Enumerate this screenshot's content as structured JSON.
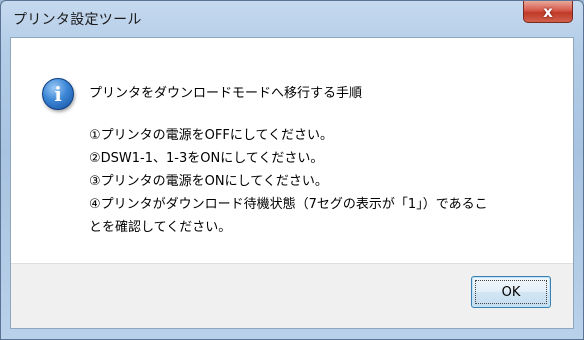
{
  "window": {
    "title": "プリンタ設定ツール",
    "close_label": "x"
  },
  "dialog": {
    "icon": "information-icon",
    "icon_glyph": "i",
    "heading": "プリンタをダウンロードモードへ移行する手順",
    "steps": [
      "①プリンタの電源をOFFにしてください。",
      "②DSW1-1、1-3をONにしてください。",
      "③プリンタの電源をONにしてください。",
      "④プリンタがダウンロード待機状態（7セグの表示が「1」）であるこ",
      "とを確認してください。"
    ],
    "ok_label": "OK"
  },
  "colors": {
    "titlebar": "#b3cde8",
    "close_button": "#c03a28",
    "footer": "#f0f0f0",
    "ok_border": "#3c7fb1"
  }
}
